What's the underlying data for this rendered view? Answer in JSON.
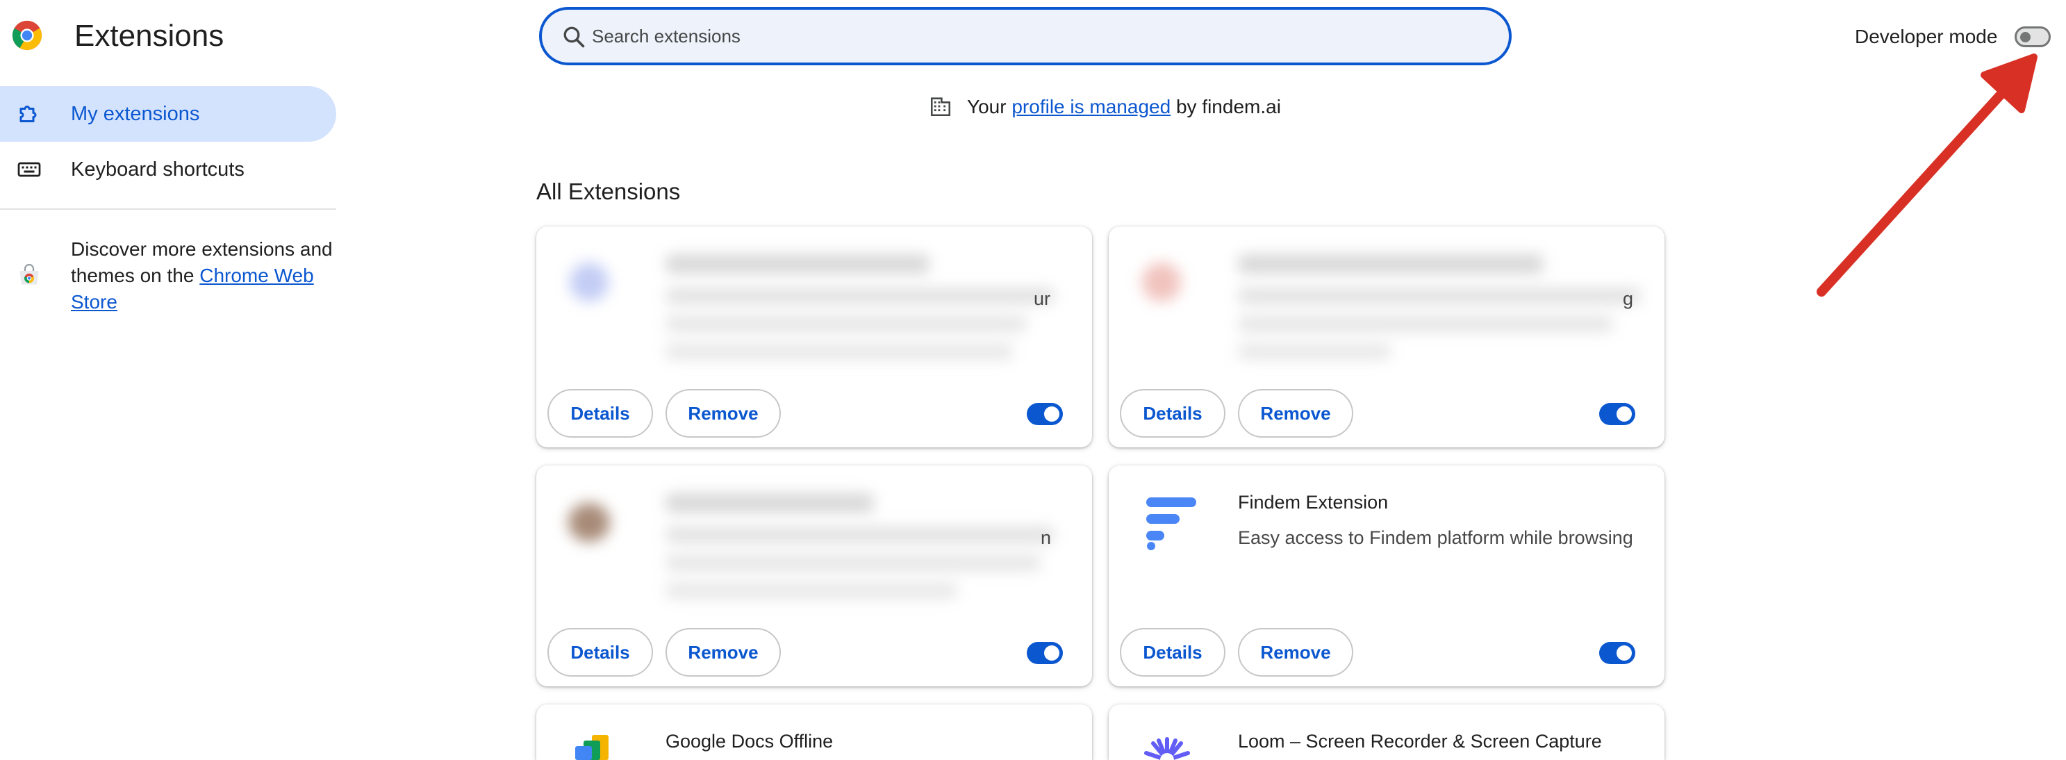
{
  "header": {
    "title": "Extensions",
    "search_placeholder": "Search extensions",
    "search_value": "",
    "developer_mode_label": "Developer mode",
    "developer_mode_on": false
  },
  "sidebar": {
    "items": [
      {
        "label": "My extensions",
        "icon": "puzzle-icon",
        "active": true
      },
      {
        "label": "Keyboard shortcuts",
        "icon": "keyboard-icon",
        "active": false
      }
    ],
    "discover_prefix": "Discover more extensions and themes on the ",
    "discover_link": "Chrome Web Store"
  },
  "managed_banner": {
    "prefix": "Your ",
    "link": "profile is managed",
    "suffix": " by findem.ai"
  },
  "section_title": "All Extensions",
  "cards": [
    {
      "name": "",
      "description": "ur",
      "blurred": true,
      "enabled": true,
      "details_label": "Details",
      "remove_label": "Remove"
    },
    {
      "name": "",
      "description": "g",
      "blurred": true,
      "enabled": true,
      "details_label": "Details",
      "remove_label": "Remove"
    },
    {
      "name": "",
      "description": "n",
      "blurred": true,
      "enabled": true,
      "details_label": "Details",
      "remove_label": "Remove"
    },
    {
      "name": "Findem Extension",
      "description": "Easy access to Findem platform while browsing",
      "blurred": false,
      "enabled": true,
      "details_label": "Details",
      "remove_label": "Remove"
    },
    {
      "name": "Google Docs Offline",
      "description": "",
      "blurred": false,
      "partial": true
    },
    {
      "name": "Loom – Screen Recorder & Screen Capture",
      "description": "",
      "blurred": false,
      "partial": true
    }
  ],
  "colors": {
    "accent": "#0b57d0",
    "active_nav_bg": "#d3e3fd",
    "search_bg": "#edf2fb",
    "annotation_arrow": "#d93025"
  }
}
